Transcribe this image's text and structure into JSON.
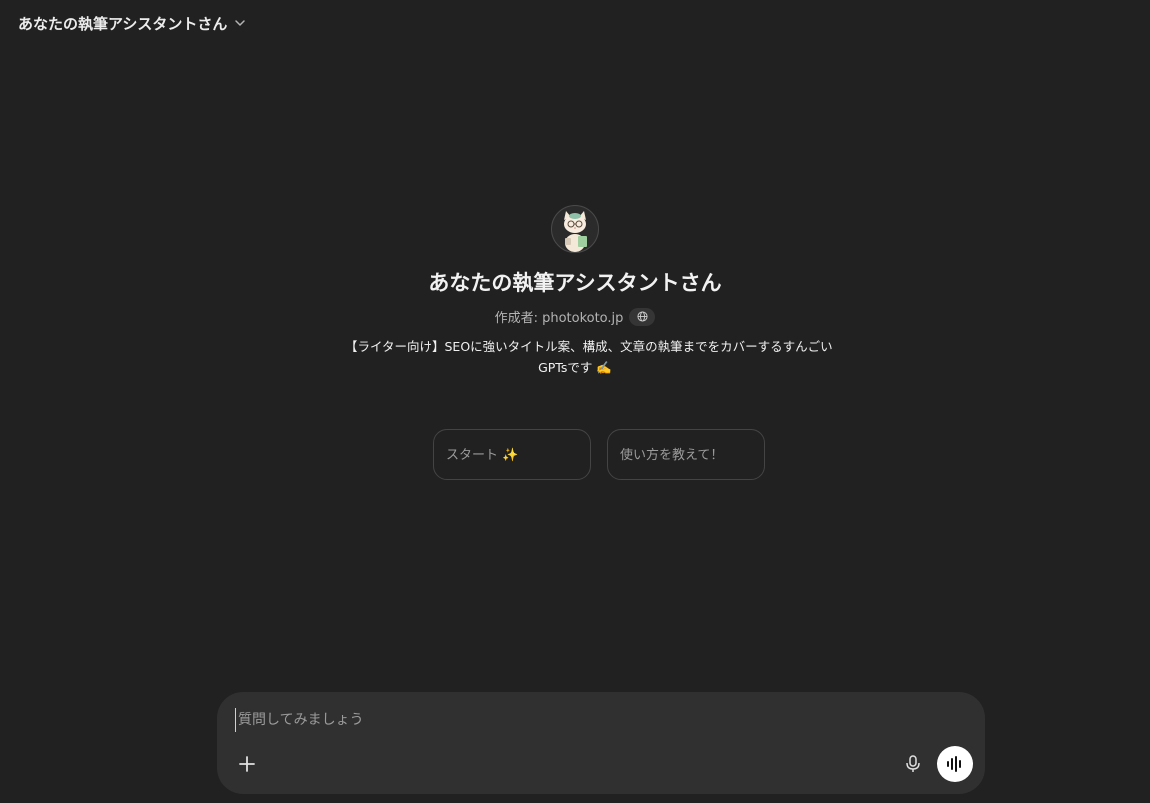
{
  "header": {
    "title": "あなたの執筆アシスタントさん",
    "chevron_icon": "chevron-down-icon"
  },
  "profile": {
    "avatar_icon": "cat-writer-avatar",
    "name": "あなたの執筆アシスタントさん",
    "author_label": "作成者: photokoto.jp",
    "globe_icon": "globe-icon",
    "description_line1": "【ライター向け】SEOに強いタイトル案、構成、文章の執筆までをカバーするすんごい",
    "description_line2": "GPTsです ✍️"
  },
  "starters": [
    {
      "label": "スタート ✨"
    },
    {
      "label": "使い方を教えて！"
    }
  ],
  "composer": {
    "placeholder": "質問してみましょう",
    "plus_icon": "plus-icon",
    "mic_icon": "microphone-icon",
    "voice_icon": "voice-mode-icon"
  },
  "colors": {
    "background": "#212121",
    "composer": "#303030",
    "text": "#ececec",
    "muted": "#9b9b9b",
    "border": "#444444"
  }
}
